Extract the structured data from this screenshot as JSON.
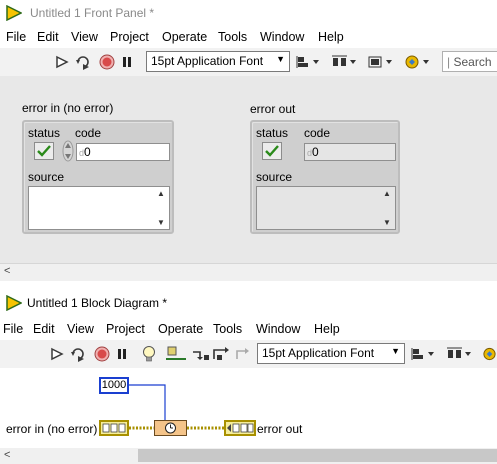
{
  "front_panel": {
    "title": "Untitled 1 Front Panel *",
    "menu": [
      "File",
      "Edit",
      "View",
      "Project",
      "Operate",
      "Tools",
      "Window",
      "Help"
    ],
    "font_select": "15pt Application Font",
    "search_placeholder": "Search",
    "error_in": {
      "label": "error in (no error)",
      "status_label": "status",
      "code_label": "code",
      "code_value": "0",
      "source_label": "source",
      "source_value": "",
      "status_checked": true
    },
    "error_out": {
      "label": "error out",
      "status_label": "status",
      "code_label": "code",
      "code_value": "0",
      "source_label": "source",
      "source_value": "",
      "status_checked": true
    }
  },
  "block_diagram": {
    "title": "Untitled 1 Block Diagram *",
    "menu": [
      "File",
      "Edit",
      "View",
      "Project",
      "Operate",
      "Tools",
      "Window",
      "Help"
    ],
    "font_select": "15pt Application Font",
    "constant_value": "1000",
    "error_in_label": "error in (no error)",
    "error_out_label": "error out",
    "function_node": "wait-ms-icon"
  },
  "colors": {
    "cluster_wire": "#a89000",
    "numeric_wire": "#1a3fd0",
    "check_green": "#2a8a1a",
    "logo_yellow": "#f7c400",
    "logo_border": "#2f6b1a",
    "run_arrow": "#3a3a3a",
    "abort_red": "#d84a4a"
  }
}
